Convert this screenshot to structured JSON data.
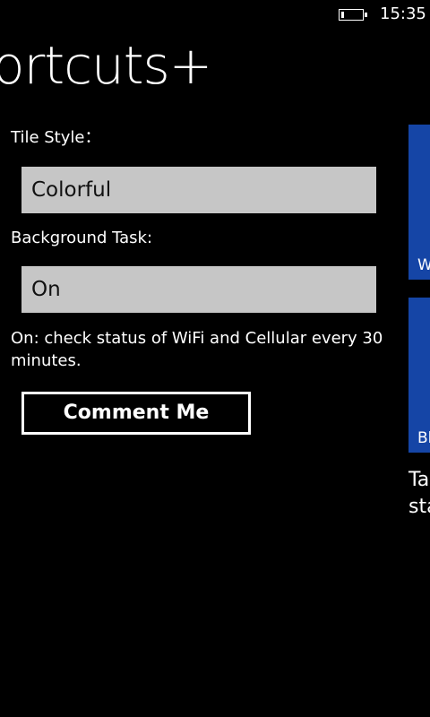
{
  "status_bar": {
    "time": "15:35"
  },
  "page": {
    "title": "ortcuts+"
  },
  "settings": {
    "tile_style": {
      "label": "Tile Style：",
      "value": "Colorful"
    },
    "background_task": {
      "label": "Background Task:",
      "value": "On",
      "description": "On: check status of WiFi and Cellular every 30 minutes."
    },
    "comment_button": "Comment Me"
  },
  "peek_panel": {
    "tiles": [
      {
        "label": "W"
      },
      {
        "label": "Bl"
      }
    ],
    "text_lines": [
      "Ta",
      "sta"
    ],
    "tile_color": "#1545a6"
  },
  "colors": {
    "background": "#000000",
    "picker_background": "#c6c6c6",
    "text": "#ffffff"
  }
}
